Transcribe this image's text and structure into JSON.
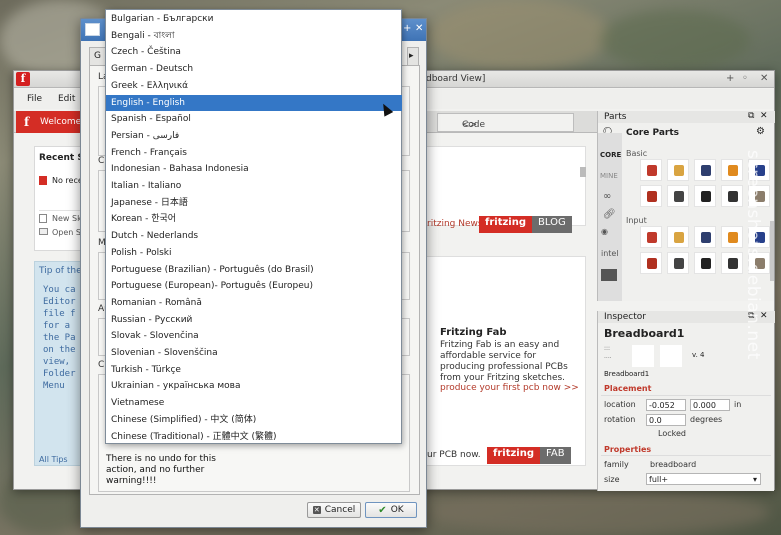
{
  "main": {
    "title": "Untitled Sketch - Fritzing - [Breadboard View]",
    "title_visible": "dboard View]",
    "menu": [
      "File",
      "Edit"
    ],
    "welcome_tab": "Welcome",
    "code_tab": "Code",
    "recent_heading": "Recent S",
    "recent_empty": "No rece",
    "new_sketch": "New Sk",
    "open_sketch": "Open S",
    "tips_heading": "Tip of the",
    "tips_lines": "You ca\nEditor\nfile f\nfor a \nthe Pa\non the\nview, \nFolder\nMenu",
    "all_tips": "All Tips",
    "news_link": "ritzing News.",
    "fab_link": "ur PCB now.",
    "fritzing": "fritzing",
    "blog": "BLOG",
    "fab": "FAB",
    "fab_title": "Fritzing Fab",
    "fab_body": "Fritzing Fab is an easy and affordable service for producing professional PCBs from your Fritzing sketches.",
    "fab_cta": "produce your first pcb now >>"
  },
  "parts": {
    "title": "Parts",
    "bin_title": "Core Parts",
    "side_tabs": [
      "CORE",
      "MINE"
    ],
    "section_basic": "Basic",
    "section_input": "Input"
  },
  "inspector": {
    "title": "Inspector",
    "part_name": "Breadboard1",
    "version": "v. 4",
    "caption": "Breadboard1",
    "placement": "Placement",
    "location_label": "location",
    "location_x": "-0.052",
    "location_y": "0.000",
    "location_unit": "in",
    "rotation_label": "rotation",
    "rotation_value": "0.0",
    "rotation_unit": "degrees",
    "locked": "Locked",
    "properties": "Properties",
    "family_label": "family",
    "family_value": "breadboard",
    "size_label": "size",
    "size_value": "full+"
  },
  "dialog": {
    "tab_label": "G",
    "group_labels": [
      "La",
      "Cu",
      "Mi",
      "Au",
      "Cl"
    ],
    "warning": "There is no undo for this\naction, and no further\nwarning!!!!",
    "cancel": "Cancel",
    "ok": "OK"
  },
  "languages": {
    "selected_index": 5,
    "items": [
      "Bulgarian - Български",
      "Bengali - বাংলা",
      "Czech - Čeština",
      "German - Deutsch",
      "Greek - Ελληνικά",
      "English - English",
      "Spanish - Español",
      "Persian - فارسی",
      "French - Français",
      "Indonesian - Bahasa Indonesia",
      "Italian - Italiano",
      "Japanese - 日本語",
      "Korean - 한국어",
      "Dutch - Nederlands",
      "Polish - Polski",
      "Portuguese (Brazilian) - Português (do Brasil)",
      "Portuguese (European)- Português (Europeu)",
      "Romanian - Română",
      "Russian - Русский",
      "Slovak - Slovenčina",
      "Slovenian - Slovenščina",
      "Turkish - Türkçe",
      "Ukrainian - українська мова",
      "Vietnamese",
      "Chinese (Simplified) - 中文 (简体)",
      "Chinese (Traditional) - 正體中文 (繁體)"
    ]
  },
  "watermark": "screenshots.debian.net"
}
